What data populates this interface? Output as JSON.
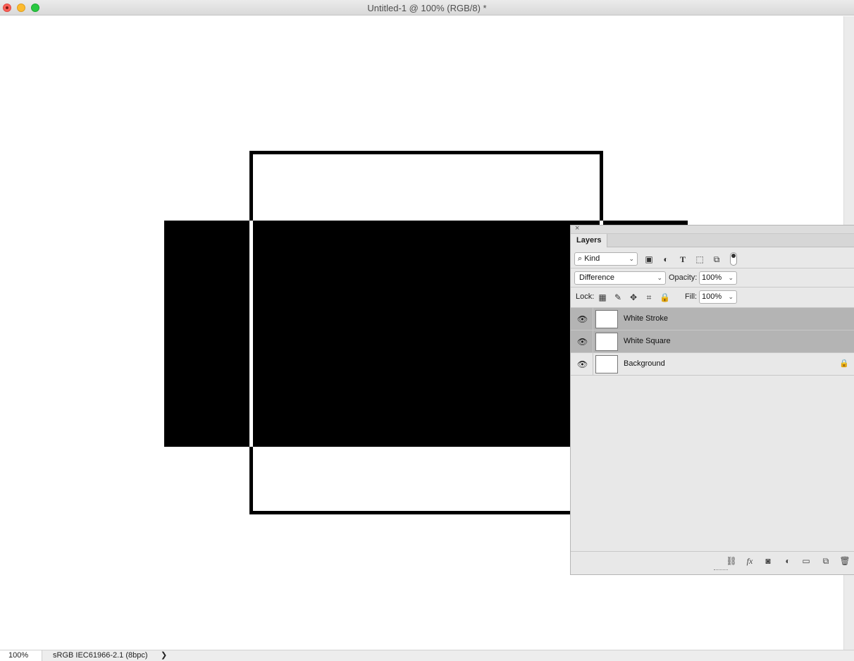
{
  "window": {
    "title": "Untitled-1 @ 100% (RGB/8) *"
  },
  "status": {
    "zoom": "100%",
    "doc_info": "sRGB IEC61966-2.1 (8bpc)",
    "arrow": "❯"
  },
  "layers_panel": {
    "close": "×",
    "tab": "Layers",
    "filter_kind": "Kind",
    "blend_mode": "Difference",
    "opacity_label": "Opacity:",
    "opacity_value": "100%",
    "lock_label": "Lock:",
    "fill_label": "Fill:",
    "fill_value": "100%",
    "layers": [
      {
        "name": "White Stroke",
        "visible": true,
        "selected": true,
        "locked": false
      },
      {
        "name": "White Square",
        "visible": true,
        "selected": true,
        "locked": false
      },
      {
        "name": "Background",
        "visible": true,
        "selected": false,
        "locked": true
      }
    ],
    "footer_icons": [
      "link-icon",
      "fx-icon",
      "mask-icon",
      "adjustment-icon",
      "folder-icon",
      "new-layer-icon",
      "trash-icon"
    ]
  },
  "icons": {
    "eye": "👁",
    "lock": "🔒",
    "chev": "⌄"
  }
}
